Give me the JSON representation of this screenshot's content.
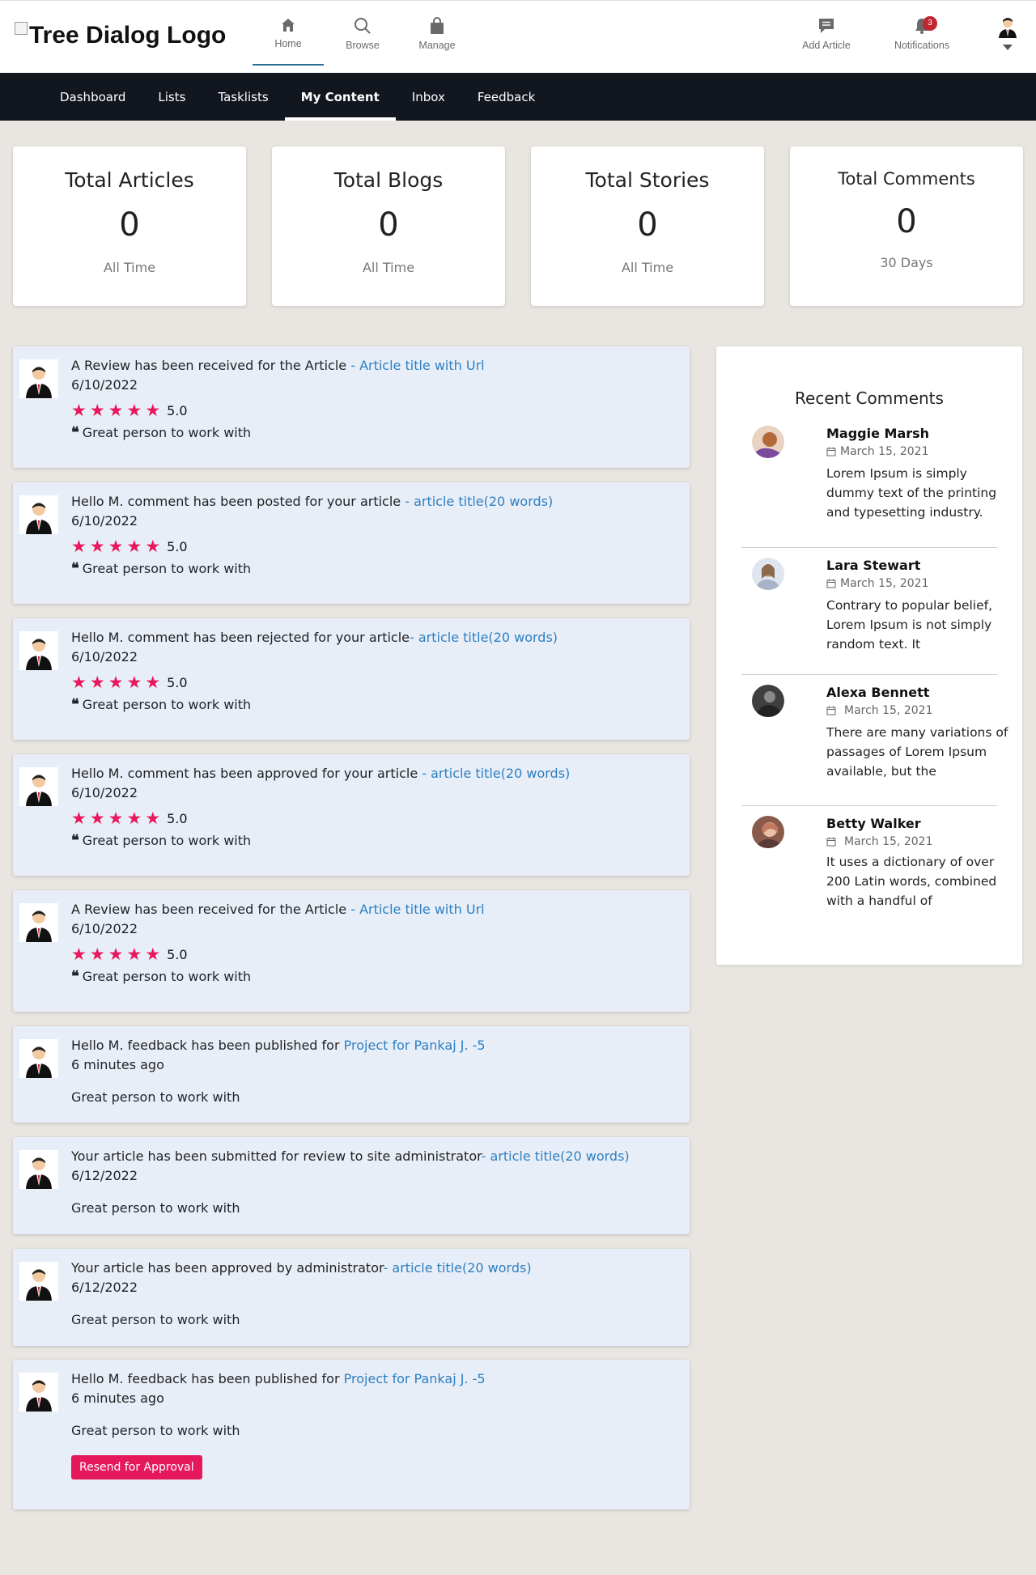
{
  "header": {
    "logo_alt": "Tree Dialog Logo",
    "nav": [
      {
        "label": "Home",
        "icon": "home-icon",
        "active": true
      },
      {
        "label": "Browse",
        "icon": "search-icon"
      },
      {
        "label": "Manage",
        "icon": "bag-icon"
      }
    ],
    "add_article_label": "Add Article",
    "notifications_label": "Notifications",
    "notifications_count": "3"
  },
  "subnav": {
    "tabs": [
      "Dashboard",
      "Lists",
      "Tasklists",
      "My Content",
      "Inbox",
      "Feedback"
    ],
    "active": "My Content"
  },
  "stats": [
    {
      "title": "Total Articles",
      "value": "0",
      "period": "All Time"
    },
    {
      "title": "Total Blogs",
      "value": "0",
      "period": "All Time"
    },
    {
      "title": "Total Stories",
      "value": "0",
      "period": "All Time"
    },
    {
      "title": "Total Comments",
      "value": "0",
      "period": "30 Days"
    }
  ],
  "feed": [
    {
      "text": "A Review has been received for the Article ",
      "link": "- Article title with Url",
      "date": "6/10/2022",
      "rating": "5.0",
      "quote": "Great person to work with"
    },
    {
      "text": "Hello M. comment has been posted for your article ",
      "link": "- article title(20 words)",
      "date": "6/10/2022",
      "rating": "5.0",
      "quote": "Great person to work with"
    },
    {
      "text": "Hello M. comment has been rejected for your article",
      "link": "- article title(20 words)",
      "date": "6/10/2022",
      "rating": "5.0",
      "quote": "Great person to work with"
    },
    {
      "text": "Hello M. comment has been approved for your article ",
      "link": "- article title(20 words)",
      "date": "6/10/2022",
      "rating": "5.0",
      "quote": "Great person to work with"
    },
    {
      "text": "A Review has been received for the Article ",
      "link": "- Article title with Url",
      "date": "6/10/2022",
      "rating": "5.0",
      "quote": "Great person to work with"
    },
    {
      "text": "Hello M. feedback has been published for ",
      "link": "Project for Pankaj J. -5",
      "date": "6 minutes ago",
      "message": "Great person to work with"
    },
    {
      "text": "Your article has been submitted for review to site administrator",
      "link": "- article title(20 words)",
      "date": "6/12/2022",
      "message": "Great person to work with"
    },
    {
      "text": "Your article has been approved by administrator",
      "link": "- article title(20 words)",
      "date": "6/12/2022",
      "message": "Great person to work with"
    },
    {
      "text": "Hello M. feedback has been published for ",
      "link": "Project for Pankaj J. -5",
      "date": "6 minutes ago",
      "message": "Great person to work with",
      "button": "Resend for Approval"
    }
  ],
  "recent_comments": {
    "title": "Recent Comments",
    "items": [
      {
        "name": "Maggie Marsh",
        "date": "March 15, 2021",
        "text": "Lorem Ipsum is simply dummy text of the printing and typesetting industry.",
        "avatar_color": "#b36a3b"
      },
      {
        "name": "Lara Stewart",
        "date": "March 15, 2021",
        "text": "Contrary to popular belief, Lorem Ipsum is not simply random text. It",
        "avatar_color": "#a8b3c7"
      },
      {
        "name": "Alexa Bennett",
        "date": "March 15, 2021",
        "text": "There are many variations of passages of Lorem Ipsum available, but the",
        "avatar_color": "#3f3f3f"
      },
      {
        "name": "Betty Walker",
        "date": "March 15, 2021",
        "text": "It uses a dictionary of over 200 Latin words, combined with a handful of",
        "avatar_color": "#c47a62"
      }
    ]
  },
  "colors": {
    "accent": "#e8185c",
    "link": "#2d7fc1",
    "subnav_bg": "#12161f",
    "card_bg": "#e8eef8",
    "page_bg": "#e9e6e1"
  }
}
